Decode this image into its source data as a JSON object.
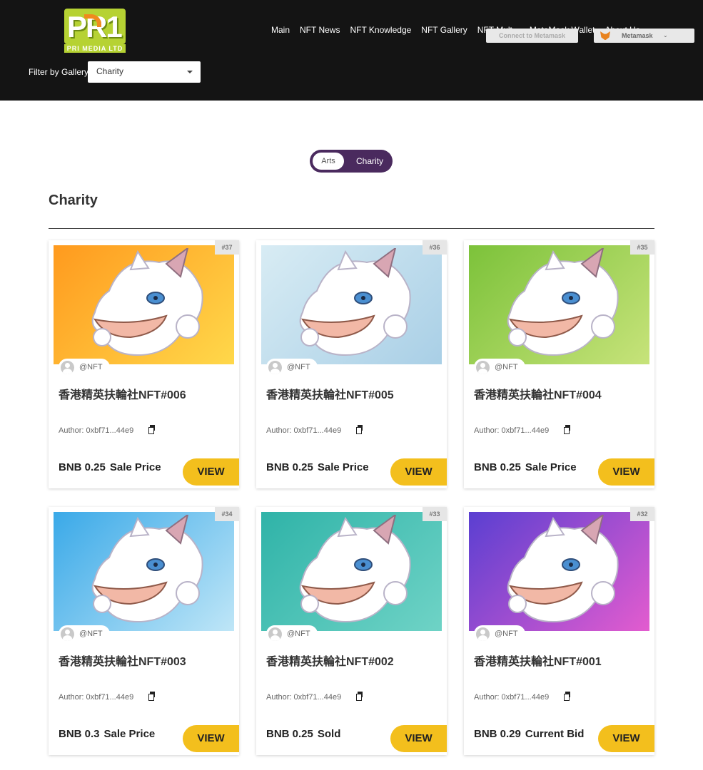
{
  "brand": {
    "logo_text": "PR1",
    "logo_subtext": "PRI MEDIA LTD"
  },
  "nav": {
    "items": [
      {
        "label": "Main"
      },
      {
        "label": "NFT News"
      },
      {
        "label": "NFT Knowledge"
      },
      {
        "label": "NFT Gallery"
      },
      {
        "label": "NFT Mult..."
      },
      {
        "label": "MetaMask Wallet"
      },
      {
        "label": "About Us"
      }
    ]
  },
  "wallet": {
    "connect_label": "Connect to Metamask",
    "selected_wallet": "Metamask"
  },
  "filter": {
    "label": "Filter by Gallery",
    "selected": "Charity"
  },
  "toggle": {
    "option_a": "Arts",
    "option_b": "Charity",
    "active": "Charity"
  },
  "section": {
    "title": "Charity"
  },
  "cards": [
    {
      "badge": "#37",
      "owner": "@NFT",
      "title": "香港精英扶輪社NFT#006",
      "author": "Author: 0xbf71...44e9",
      "currency": "BNB",
      "price": "0.25",
      "status": "Sale Price",
      "button": "VIEW",
      "bg_start": "#ff9a1e",
      "bg_end": "#ffd84a"
    },
    {
      "badge": "#36",
      "owner": "@NFT",
      "title": "香港精英扶輪社NFT#005",
      "author": "Author: 0xbf71...44e9",
      "currency": "BNB",
      "price": "0.25",
      "status": "Sale Price",
      "button": "VIEW",
      "bg_start": "#d8ecf4",
      "bg_end": "#a9cfe6"
    },
    {
      "badge": "#35",
      "owner": "@NFT",
      "title": "香港精英扶輪社NFT#004",
      "author": "Author: 0xbf71...44e9",
      "currency": "BNB",
      "price": "0.25",
      "status": "Sale Price",
      "button": "VIEW",
      "bg_start": "#7cc23a",
      "bg_end": "#c7e37a"
    },
    {
      "badge": "#34",
      "owner": "@NFT",
      "title": "香港精英扶輪社NFT#003",
      "author": "Author: 0xbf71...44e9",
      "currency": "BNB",
      "price": "0.3",
      "status": "Sale Price",
      "button": "VIEW",
      "bg_start": "#3aa9e8",
      "bg_end": "#bfe6f7"
    },
    {
      "badge": "#33",
      "owner": "@NFT",
      "title": "香港精英扶輪社NFT#002",
      "author": "Author: 0xbf71...44e9",
      "currency": "BNB",
      "price": "0.25",
      "status": "Sold",
      "button": "VIEW",
      "bg_start": "#2fb3a8",
      "bg_end": "#6fd3c6"
    },
    {
      "badge": "#32",
      "owner": "@NFT",
      "title": "香港精英扶輪社NFT#001",
      "author": "Author: 0xbf71...44e9",
      "currency": "BNB",
      "price": "0.29",
      "status": "Current Bid",
      "button": "VIEW",
      "bg_start": "#5a3fd1",
      "bg_end": "#e35ccf"
    }
  ],
  "colors": {
    "header_bg": "#141414",
    "toggle_bg": "#4a2a5e",
    "view_button": "#f3bf1d",
    "logo_green": "#b6d233"
  }
}
